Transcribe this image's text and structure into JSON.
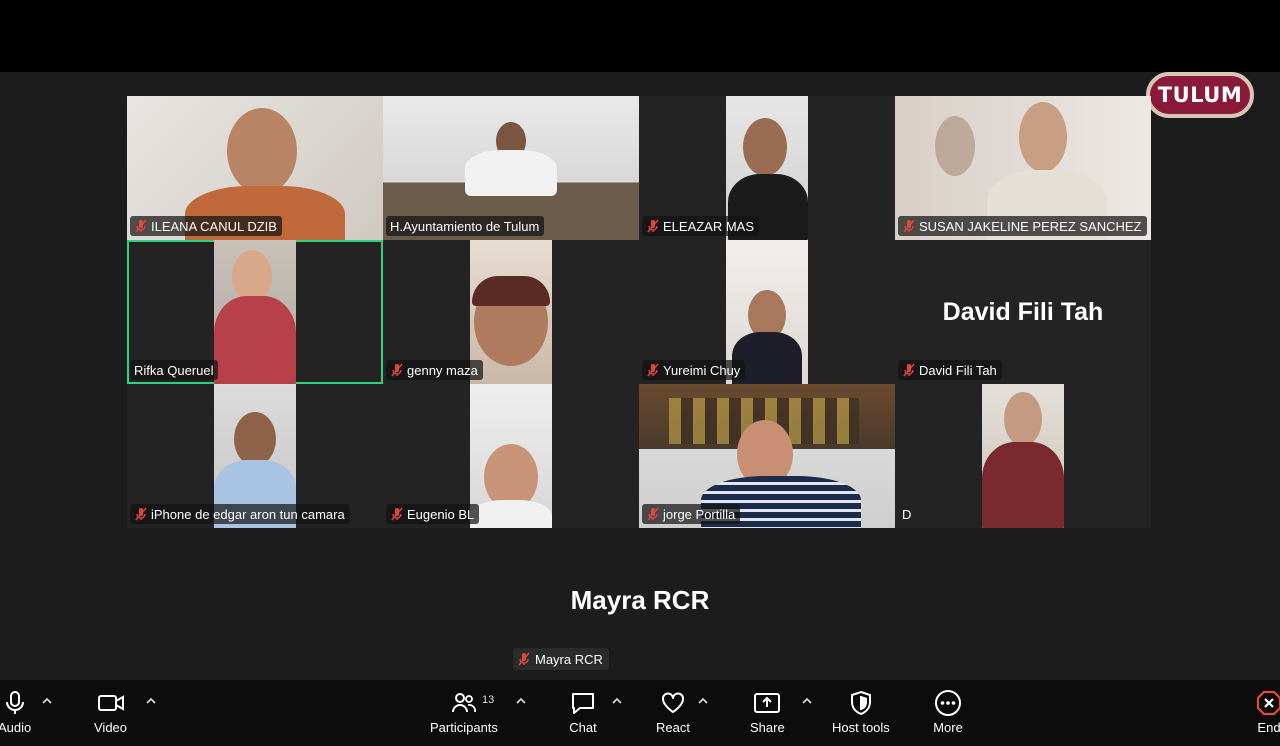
{
  "logo": {
    "text": "TULUM"
  },
  "participants": [
    {
      "name": "ILEANA CANUL DZIB",
      "muted": true
    },
    {
      "name": "H.Ayuntamiento de Tulum",
      "muted": false
    },
    {
      "name": "ELEAZAR MAS",
      "muted": true
    },
    {
      "name": "SUSAN JAKELINE PEREZ SANCHEZ",
      "muted": true
    },
    {
      "name": "Rifka Queruel",
      "muted": false
    },
    {
      "name": "genny maza",
      "muted": true
    },
    {
      "name": "Yureimi Chuy",
      "muted": true
    },
    {
      "name": "David Fili Tah",
      "muted": true,
      "big_label": "David Fili Tah"
    },
    {
      "name": "iPhone de edgar aron  tun camara",
      "muted": true
    },
    {
      "name": "Eugenio BL",
      "muted": true
    },
    {
      "name": "jorge Portilla",
      "muted": true
    },
    {
      "name": "D",
      "muted": false
    }
  ],
  "speaker": {
    "big_label": "Mayra RCR",
    "tag": "Mayra RCR"
  },
  "toolbar": {
    "audio": "Audio",
    "video": "Video",
    "participants": "Participants",
    "participant_count": "13",
    "chat": "Chat",
    "react": "React",
    "share": "Share",
    "host_tools": "Host tools",
    "more": "More",
    "end": "End"
  },
  "colors": {
    "active_border": "#2fd27a",
    "mute_red": "#e0483d",
    "logo_bg": "#8b1a3a"
  }
}
